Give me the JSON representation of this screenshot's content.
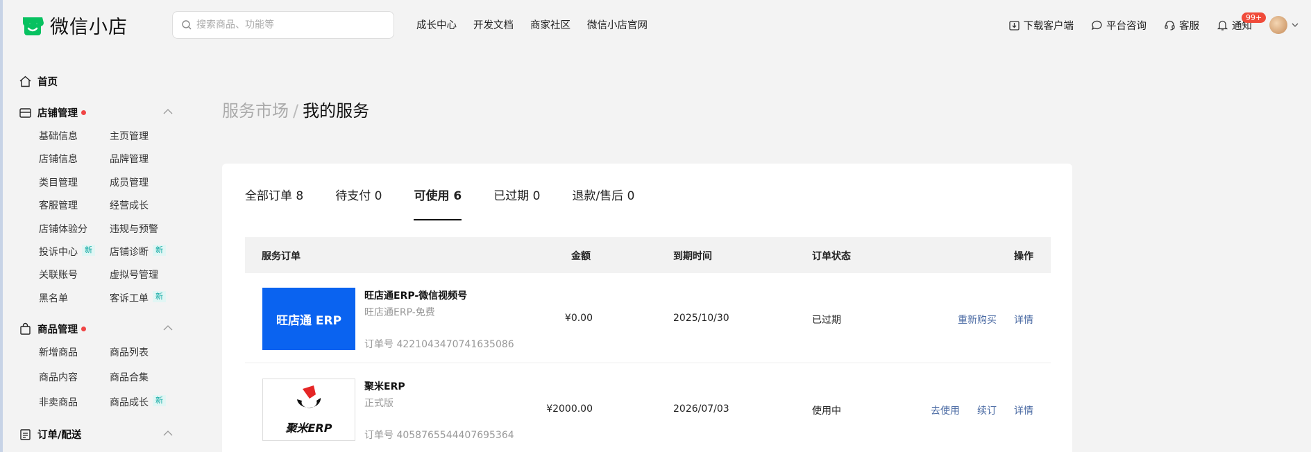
{
  "brand": {
    "name": "微信小店",
    "color": "#07c160"
  },
  "search": {
    "placeholder": "搜索商品、功能等"
  },
  "topnav": [
    "成长中心",
    "开发文档",
    "商家社区",
    "微信小店官网"
  ],
  "tools": {
    "download": "下载客户端",
    "consult": "平台咨询",
    "service": "客服",
    "notify": "通知",
    "notify_badge": "99+"
  },
  "sidebar": {
    "home": "首页",
    "sections": [
      {
        "title": "店铺管理",
        "items": [
          {
            "label": "基础信息",
            "new": ""
          },
          {
            "label": "主页管理",
            "new": ""
          },
          {
            "label": "店铺信息",
            "new": ""
          },
          {
            "label": "品牌管理",
            "new": ""
          },
          {
            "label": "类目管理",
            "new": ""
          },
          {
            "label": "成员管理",
            "new": ""
          },
          {
            "label": "客服管理",
            "new": ""
          },
          {
            "label": "经营成长",
            "new": ""
          },
          {
            "label": "店铺体验分",
            "new": ""
          },
          {
            "label": "违规与预警",
            "new": ""
          },
          {
            "label": "投诉中心",
            "new": "新"
          },
          {
            "label": "店铺诊断",
            "new": "新"
          },
          {
            "label": "关联账号",
            "new": ""
          },
          {
            "label": "虚拟号管理",
            "new": ""
          },
          {
            "label": "黑名单",
            "new": ""
          },
          {
            "label": "客诉工单",
            "new": "新"
          }
        ]
      },
      {
        "title": "商品管理",
        "items": [
          {
            "label": "新增商品",
            "new": ""
          },
          {
            "label": "商品列表",
            "new": ""
          },
          {
            "label": "商品内容",
            "new": ""
          },
          {
            "label": "商品合集",
            "new": ""
          },
          {
            "label": "非卖商品",
            "new": ""
          },
          {
            "label": "商品成长",
            "new": "新"
          }
        ]
      },
      {
        "title": "订单/配送",
        "items": []
      }
    ]
  },
  "breadcrumb": {
    "parent": "服务市场",
    "separator": "/",
    "current": "我的服务"
  },
  "tabs": [
    {
      "label": "全部订单 8",
      "active": false
    },
    {
      "label": "待支付 0",
      "active": false
    },
    {
      "label": "可使用 6",
      "active": true
    },
    {
      "label": "已过期 0",
      "active": false
    },
    {
      "label": "退款/售后 0",
      "active": false
    }
  ],
  "table": {
    "headers": {
      "order": "服务订单",
      "amount": "金额",
      "expire": "到期时间",
      "status": "订单状态",
      "ops": "操作"
    },
    "rows": [
      {
        "logo": "wangdiantong",
        "logo_text": "旺店通 ERP",
        "name": "旺店通ERP-微信视频号",
        "plan": "旺店通ERP-免费",
        "order_no": "订单号 4221043470741635086",
        "amount": "¥0.00",
        "expire": "2025/10/30",
        "status": "已过期",
        "actions": [
          "重新购买",
          "详情"
        ]
      },
      {
        "logo": "jumi",
        "logo_text": "聚米ERP",
        "name": "聚米ERP",
        "plan": "正式版",
        "order_no": "订单号 4058765544407695364",
        "amount": "¥2000.00",
        "expire": "2026/07/03",
        "status": "使用中",
        "actions": [
          "去使用",
          "续订",
          "详情"
        ]
      }
    ]
  }
}
